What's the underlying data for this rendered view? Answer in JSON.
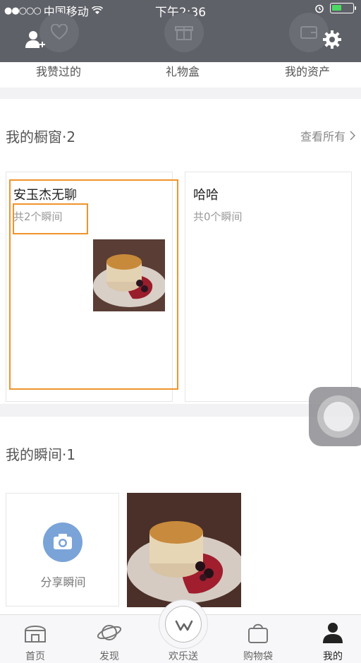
{
  "status_bar": {
    "carrier": "中国移动",
    "time": "下午2:36"
  },
  "top_menu": {
    "liked": "我赞过的",
    "gift_box": "礼物盒",
    "assets": "我的资产"
  },
  "showcase": {
    "title": "我的橱窗·2",
    "see_all": "查看所有",
    "cards": [
      {
        "title": "安玉杰无聊",
        "subtitle": "共2个瞬间"
      },
      {
        "title": "哈哈",
        "subtitle": "共0个瞬间"
      }
    ]
  },
  "moments": {
    "title": "我的瞬间·1",
    "share_label": "分享瞬间"
  },
  "tabbar": {
    "items": [
      {
        "label": "首页",
        "icon": "home-icon"
      },
      {
        "label": "发现",
        "icon": "planet-icon"
      },
      {
        "label": "欢乐送",
        "icon": "w-logo-icon"
      },
      {
        "label": "购物袋",
        "icon": "bag-icon"
      },
      {
        "label": "我的",
        "icon": "person-icon"
      }
    ],
    "active_index": 4
  },
  "colors": {
    "header": "#5f6168",
    "highlight": "#f0932b",
    "camera_badge": "#7aa3d8"
  }
}
